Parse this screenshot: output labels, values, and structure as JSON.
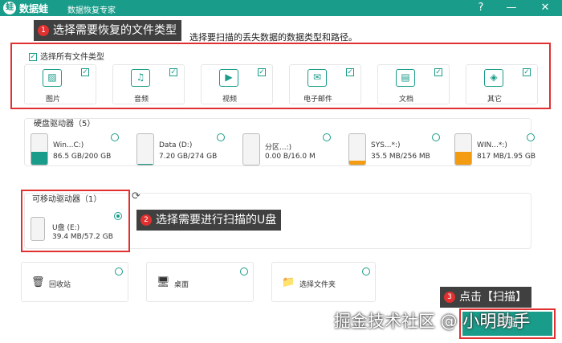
{
  "titlebar": {
    "logo_char": "蛙",
    "app_name": "数据蛙",
    "app_subtitle": "数据恢复专家",
    "help": "?",
    "minimize": "—",
    "close": "✕"
  },
  "callouts": {
    "step1_num": "1",
    "step1_text": "选择需要恢复的文件类型",
    "step2_num": "2",
    "step2_text": "选择需要进行扫描的U盘",
    "step3_num": "3",
    "step3_text": "点击【扫描】"
  },
  "instruction": "选择要扫描的丢失数据的数据类型和路径。",
  "file_types": {
    "select_all_label": "选择所有文件类型",
    "items": [
      {
        "label": "图片",
        "icon": "image-icon",
        "glyph": "▨",
        "checked": true
      },
      {
        "label": "音频",
        "icon": "music-icon",
        "glyph": "♫",
        "checked": true
      },
      {
        "label": "视频",
        "icon": "video-icon",
        "glyph": "▶",
        "checked": true
      },
      {
        "label": "电子邮件",
        "icon": "email-icon",
        "glyph": "✉",
        "checked": true
      },
      {
        "label": "文档",
        "icon": "document-icon",
        "glyph": "▤",
        "checked": true
      },
      {
        "label": "其它",
        "icon": "other-icon",
        "glyph": "◈",
        "checked": true
      }
    ]
  },
  "hard_drives": {
    "title": "硬盘驱动器（5）",
    "items": [
      {
        "name": "Win...C:)",
        "size": "86.5 GB/200 GB",
        "fill_pct": 43,
        "color": "#1a9c8a"
      },
      {
        "name": "Data (D:)",
        "size": "7.20 GB/274 GB",
        "fill_pct": 3,
        "color": "#1a9c8a"
      },
      {
        "name": "分区...:)",
        "size": "0.00  B/16.0 M",
        "fill_pct": 0,
        "color": "#1a9c8a"
      },
      {
        "name": "SYS...*:)",
        "size": "35.5 MB/256 MB",
        "fill_pct": 14,
        "color": "#f39c12"
      },
      {
        "name": "WIN...*:)",
        "size": "817 MB/1.95 GB",
        "fill_pct": 42,
        "color": "#f39c12"
      }
    ]
  },
  "removable": {
    "title": "可移动驱动器（1）",
    "refresh_icon": "⟳",
    "drive_name": "U盘 (E:)",
    "drive_size": "39.4 MB/57.2 GB",
    "fill_pct": 1
  },
  "locations": [
    {
      "label": "回收站",
      "icon": "recycle-bin-icon",
      "glyph": "🗑"
    },
    {
      "label": "桌面",
      "icon": "desktop-icon",
      "glyph": "🖥"
    },
    {
      "label": "选择文件夹",
      "icon": "folder-icon",
      "glyph": "📁"
    }
  ],
  "scan_button": "扫描",
  "watermark": "掘金技术社区 @ 小明助手",
  "colors": {
    "accent": "#1a9c8a",
    "highlight": "#e0302f",
    "warn": "#f39c12"
  }
}
